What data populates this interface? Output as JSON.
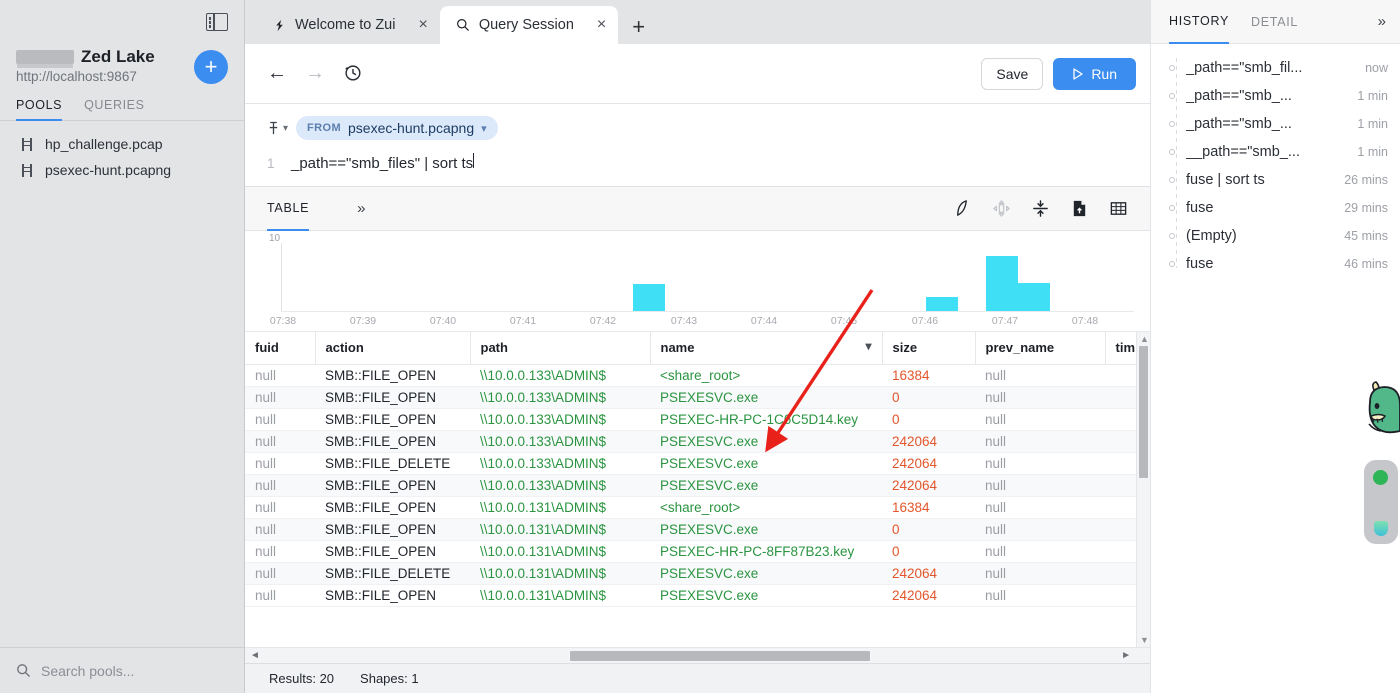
{
  "sidebar": {
    "panel_toggle_icon": "panel-toggle-icon",
    "lake_name": "Zed Lake",
    "lake_url": "http://localhost:9867",
    "add_label": "+",
    "tabs": [
      {
        "label": "POOLS",
        "active": true
      },
      {
        "label": "QUERIES",
        "active": false
      }
    ],
    "pools": [
      {
        "label": "hp_challenge.pcap"
      },
      {
        "label": "psexec-hunt.pcapng"
      }
    ],
    "search_placeholder": "Search pools..."
  },
  "tabbar": {
    "tabs": [
      {
        "label": "Welcome to Zui",
        "icon": "zui-logo-icon",
        "active": false,
        "close": "×"
      },
      {
        "label": "Query Session",
        "icon": "search-icon",
        "active": true,
        "close": "×"
      }
    ],
    "new_tab_label": "+"
  },
  "querybar": {
    "back_icon": "arrow-left-icon",
    "forward_icon": "arrow-right-icon",
    "history_icon": "clock-history-icon",
    "save_label": "Save",
    "run_label": "Run"
  },
  "editor": {
    "pin_icon": "pin-icon",
    "from_keyword": "FROM",
    "from_pool": "psexec-hunt.pcapng",
    "line_number": "1",
    "query_text": "_path==\"smb_files\" | sort ts"
  },
  "results": {
    "tab_label": "TABLE",
    "expand_icon": "chevron-double-right-icon",
    "toolbar_icons": [
      "zed-fin-icon",
      "expand-arrows-icon",
      "collapse-vertical-icon",
      "export-file-icon",
      "table-grid-icon"
    ],
    "columns": [
      "fuid",
      "action",
      "path",
      "name",
      "size",
      "prev_name",
      "tim"
    ],
    "name_sort_icon": "chevron-down-icon",
    "rows": [
      {
        "fuid": "null",
        "action": "SMB::FILE_OPEN",
        "path": "\\\\10.0.0.133\\ADMIN$",
        "name": "<share_root>",
        "size": "16384",
        "prev_name": "null"
      },
      {
        "fuid": "null",
        "action": "SMB::FILE_OPEN",
        "path": "\\\\10.0.0.133\\ADMIN$",
        "name": "PSEXESVC.exe",
        "size": "0",
        "prev_name": "null"
      },
      {
        "fuid": "null",
        "action": "SMB::FILE_OPEN",
        "path": "\\\\10.0.0.133\\ADMIN$",
        "name": "PSEXEC-HR-PC-1C6C5D14.key",
        "size": "0",
        "prev_name": "null"
      },
      {
        "fuid": "null",
        "action": "SMB::FILE_OPEN",
        "path": "\\\\10.0.0.133\\ADMIN$",
        "name": "PSEXESVC.exe",
        "size": "242064",
        "prev_name": "null"
      },
      {
        "fuid": "null",
        "action": "SMB::FILE_DELETE",
        "path": "\\\\10.0.0.133\\ADMIN$",
        "name": "PSEXESVC.exe",
        "size": "242064",
        "prev_name": "null"
      },
      {
        "fuid": "null",
        "action": "SMB::FILE_OPEN",
        "path": "\\\\10.0.0.133\\ADMIN$",
        "name": "PSEXESVC.exe",
        "size": "242064",
        "prev_name": "null"
      },
      {
        "fuid": "null",
        "action": "SMB::FILE_OPEN",
        "path": "\\\\10.0.0.131\\ADMIN$",
        "name": "<share_root>",
        "size": "16384",
        "prev_name": "null"
      },
      {
        "fuid": "null",
        "action": "SMB::FILE_OPEN",
        "path": "\\\\10.0.0.131\\ADMIN$",
        "name": "PSEXESVC.exe",
        "size": "0",
        "prev_name": "null"
      },
      {
        "fuid": "null",
        "action": "SMB::FILE_OPEN",
        "path": "\\\\10.0.0.131\\ADMIN$",
        "name": "PSEXEC-HR-PC-8FF87B23.key",
        "size": "0",
        "prev_name": "null"
      },
      {
        "fuid": "null",
        "action": "SMB::FILE_DELETE",
        "path": "\\\\10.0.0.131\\ADMIN$",
        "name": "PSEXESVC.exe",
        "size": "242064",
        "prev_name": "null"
      },
      {
        "fuid": "null",
        "action": "SMB::FILE_OPEN",
        "path": "\\\\10.0.0.131\\ADMIN$",
        "name": "PSEXESVC.exe",
        "size": "242064",
        "prev_name": "null"
      }
    ],
    "row_chevron": "›"
  },
  "chart_data": {
    "type": "bar",
    "title": "",
    "xlabel": "",
    "ylabel": "",
    "ylim": [
      0,
      10
    ],
    "y_tick_label": "10",
    "grid": false,
    "tick_labels": [
      "07:38",
      "07:39",
      "07:40",
      "07:41",
      "07:42",
      "07:43",
      "07:44",
      "07:45",
      "07:46",
      "07:47",
      "07:48"
    ],
    "categories": [
      "07:42",
      "07:45.8",
      "07:46.4",
      "07:46.8"
    ],
    "values": [
      3,
      1.5,
      8,
      3.5
    ],
    "bar_color": "#3fe0f5"
  },
  "statusbar": {
    "results_label": "Results: 20",
    "shapes_label": "Shapes: 1"
  },
  "right_panel": {
    "tabs": [
      {
        "label": "HISTORY",
        "active": true
      },
      {
        "label": "DETAIL",
        "active": false
      }
    ],
    "expand_icon": "chevron-double-right-icon",
    "history": [
      {
        "query": "_path==\"smb_fil...",
        "age": "now"
      },
      {
        "query": "_path==\"smb_...",
        "age": "1 min"
      },
      {
        "query": "_path==\"smb_...",
        "age": "1 min"
      },
      {
        "query": "__path==\"smb_...",
        "age": "1 min"
      },
      {
        "query": "fuse | sort ts",
        "age": "26 mins"
      },
      {
        "query": "fuse",
        "age": "29 mins"
      },
      {
        "query": "(Empty)",
        "age": "45 mins"
      },
      {
        "query": "fuse",
        "age": "46 mins"
      }
    ]
  },
  "overlay": {
    "mascot_icon": "dinosaur-mascot-icon",
    "widget_status_icon": "green-status-dot-icon",
    "widget_shield_icon": "shield-icon",
    "annotation_icon": "red-arrow-annotation"
  },
  "colors": {
    "accent": "#3b8df0",
    "bar": "#3fe0f5",
    "string_green": "#2a9440",
    "number_orange": "#e3562b",
    "null_gray": "#9b9ea4",
    "annotation_red": "#e8221b"
  }
}
